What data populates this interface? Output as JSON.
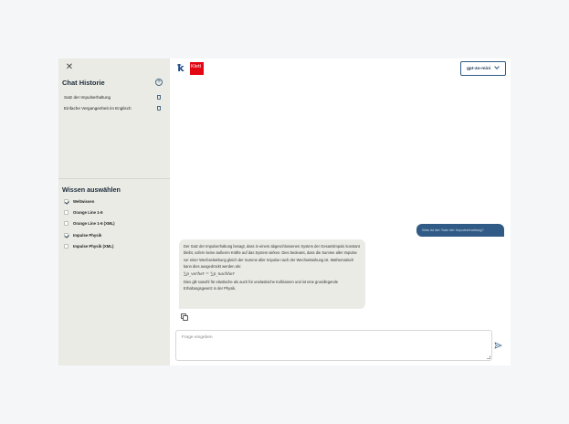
{
  "sidebar": {
    "history_title": "Chat Historie",
    "history": [
      {
        "label": "Satz der Impulserhaltung"
      },
      {
        "label": "Einfache Vergangenheit im Englisch"
      }
    ],
    "knowledge_title": "Wissen auswählen",
    "knowledge": [
      {
        "label": "Weltwissen",
        "checked": true
      },
      {
        "label": "Orange Line 1-6",
        "checked": false
      },
      {
        "label": "Orange Line 1-6 (XML)",
        "checked": false
      },
      {
        "label": "Impulse Physik",
        "checked": true
      },
      {
        "label": "Impulse Physik (XML)",
        "checked": false
      }
    ]
  },
  "header": {
    "logo_text": "Klett",
    "model_selected": "gpt-4o-mini"
  },
  "chat": {
    "user_message": "Was ist der Satz der Impulserhaltung?",
    "assistant_paragraph_1": "Der Satz der Impulserhaltung besagt, dass in einem abgeschlossenen System der Gesamtimpuls konstant bleibt, sofern keine äußeren Kräfte auf das System wirken. Dies bedeutet, dass die Summe aller Impulse vor einer Wechselwirkung gleich der Summe aller Impulse nach der Wechselwirkung ist. Mathematisch kann dies ausgedrückt werden als:",
    "formula": "∑p_vorher = ∑p_nachher",
    "assistant_paragraph_2": "Dies gilt sowohl für elastische als auch für unelastische Kollisionen und ist eine grundlegende Erhaltungsgesetz in der Physik."
  },
  "input": {
    "placeholder": "Frage eingeben"
  },
  "colors": {
    "accent": "#2f5b86",
    "sidebar_bg": "#ebebe6",
    "brand_red": "#e30613"
  }
}
